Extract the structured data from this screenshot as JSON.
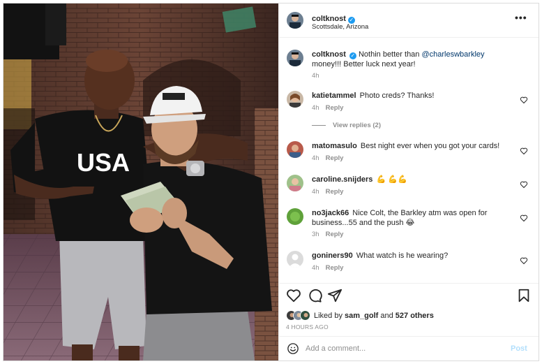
{
  "post": {
    "author": "coltknost",
    "location": "Scottsdale, Arizona",
    "more_icon": "more-horizontal-icon"
  },
  "photo": {
    "shirt_text": "USA",
    "alt_hint": "photo-of-two-men-holding-cash"
  },
  "caption": {
    "username": "coltknost",
    "text_before": "Nothin better than ",
    "mention": "@charleswbarkley",
    "text_after": " money!!! Better luck next year!",
    "time": "4h"
  },
  "comments": [
    {
      "username": "katietammel",
      "text": "Photo creds? Thanks!",
      "time": "4h",
      "reply_label": "Reply",
      "view_replies": "View replies (2)"
    },
    {
      "username": "matomasulo",
      "text": "Best night ever when you got your cards!",
      "time": "4h",
      "reply_label": "Reply"
    },
    {
      "username": "caroline.snijders",
      "text": "💪 💪💪",
      "time": "4h",
      "reply_label": "Reply"
    },
    {
      "username": "no3jack66",
      "text": "Nice Colt, the Barkley atm was open for business...55 and the push 😂",
      "time": "3h",
      "reply_label": "Reply"
    },
    {
      "username": "goniners90",
      "text": "What watch is he wearing?",
      "time": "4h",
      "reply_label": "Reply"
    }
  ],
  "actions": {
    "like_icon": "heart-icon",
    "comment_icon": "comment-icon",
    "share_icon": "share-icon",
    "save_icon": "bookmark-icon"
  },
  "likes": {
    "prefix": "Liked by ",
    "user": "sam_golf",
    "middle": " and ",
    "others": "527 others"
  },
  "time_ago": "4 HOURS AGO",
  "add_comment": {
    "placeholder": "Add a comment...",
    "post_label": "Post"
  },
  "colors": {
    "verified": "#1d9bf0",
    "mention": "#00376b",
    "post_disabled": "#b2dffc",
    "muted": "#8e8e8e"
  }
}
